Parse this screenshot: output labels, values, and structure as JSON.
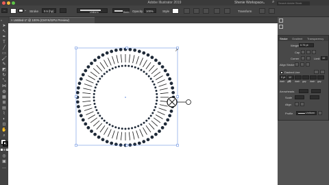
{
  "app": {
    "title": "Adobe Illustrator 2019"
  },
  "workspace": {
    "label": "Shenie Workspace",
    "search_placeholder": "Search Adobe Stock"
  },
  "control_bar": {
    "selection_label": "Stroke",
    "stroke_weight": "0.5 (hp)",
    "profile_label": "Uniform",
    "brush_label": "Basic",
    "opacity_label": "Opacity",
    "opacity_value": "100%",
    "style_label": "Style",
    "transform_label": "Transform"
  },
  "document_tab": {
    "label": "Untitled-1* @ 100% (CMYK/GPU Preview)"
  },
  "tools": [
    "selection-tool",
    "direct-selection-tool",
    "pen-tool",
    "type-tool",
    "line-tool",
    "rectangle-tool",
    "brush-tool",
    "pencil-tool",
    "eraser-tool",
    "rotate-tool",
    "scale-tool",
    "width-tool",
    "shape-builder-tool",
    "perspective-tool",
    "mesh-tool",
    "gradient-tool",
    "eyedropper-tool",
    "blend-tool",
    "symbol-tool",
    "graph-tool",
    "artboard-tool",
    "slice-tool",
    "hand-tool",
    "zoom-tool"
  ],
  "panel": {
    "tabs": [
      "Stroke",
      "Gradient",
      "Transparency"
    ],
    "weight_label": "Weight",
    "weight_value": "0.75 pt",
    "cap_label": "Cap",
    "corner_label": "Corner",
    "limit_label": "Limit",
    "limit_value": "10",
    "align_label": "Align Stroke",
    "dashed_label": "Dashed Line",
    "dash_values": [
      "0 pt",
      "12 pt",
      "",
      "",
      "",
      ""
    ],
    "dash_headers": [
      "dash",
      "gap",
      "dash",
      "gap",
      "dash",
      "gap"
    ],
    "arrowheads_label": "Arrowheads",
    "scale_label": "Scale",
    "align_arrows_label": "Align",
    "profile_label": "Profile",
    "profile_value": "Uniform"
  },
  "colors": {
    "fill": "#ffffff",
    "stroke": "#111111",
    "accent": "#4b7bd9"
  }
}
